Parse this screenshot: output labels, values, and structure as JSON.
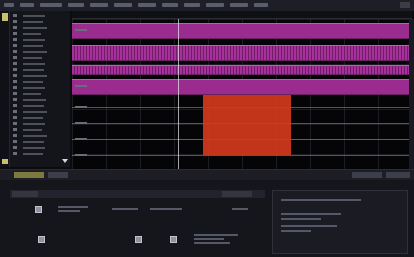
{
  "app": {
    "menu_items": [],
    "tabs": []
  },
  "colors": {
    "bus_band": "#9a2c90",
    "selection_highlight": "#d23a1c",
    "background": "#050507",
    "chrome": "#1d1e26",
    "active_channel": "#7d7a40"
  },
  "icons": [
    "menu-icon",
    "checkbox-icon"
  ],
  "bottom_panel": {
    "fields": [],
    "right_panel_lines": []
  }
}
